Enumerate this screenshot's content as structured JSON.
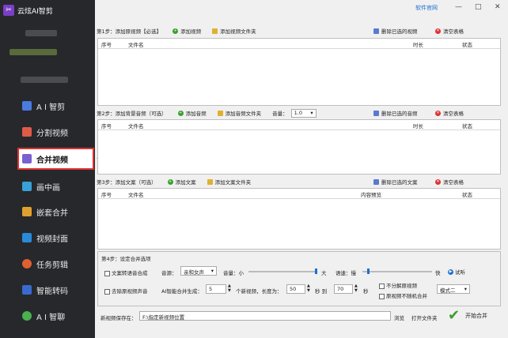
{
  "app": {
    "title": "云炫AI智剪"
  },
  "sidebar": {
    "items": [
      {
        "label": "A I 智剪",
        "color": "#4a7be0"
      },
      {
        "label": "分割视频",
        "color": "#e05a4a"
      },
      {
        "label": "合并视频",
        "color": "#7a5fd0"
      },
      {
        "label": "画中画",
        "color": "#3aa0d8"
      },
      {
        "label": "嵌套合并",
        "color": "#e0a030"
      },
      {
        "label": "视频封面",
        "color": "#2a8ad8"
      },
      {
        "label": "任务剪辑",
        "color": "#e06030"
      },
      {
        "label": "智能转码",
        "color": "#3a6ad0"
      },
      {
        "label": "A I 智聊",
        "color": "#4ab050"
      }
    ]
  },
  "titlebar": {
    "official": "软件官网",
    "minimize": "—",
    "maximize": "□",
    "close": "✕"
  },
  "step1": {
    "title": "第1步：添加原视频【必选】",
    "add": "添加视频",
    "add_folder": "添加视频文件夹",
    "delete": "删除已选的视频",
    "clear": "清空表格",
    "cols": [
      "序号",
      "文件名",
      "时长",
      "状态"
    ]
  },
  "step2": {
    "title": "第2步：添加背景音频（可选）",
    "add": "添加音频",
    "add_folder": "添加音频文件夹",
    "volume_label": "音量：",
    "volume": "1.0",
    "delete": "删除已选的音频",
    "clear": "清空表格",
    "cols": [
      "序号",
      "文件名",
      "时长",
      "状态"
    ]
  },
  "step3": {
    "title": "第3步：添加文案（可选）",
    "add": "添加文案",
    "add_folder": "添加文案文件夹",
    "delete": "删除已选的文案",
    "clear": "清空表格",
    "cols": [
      "序号",
      "文件名",
      "内容预览",
      "状态"
    ]
  },
  "step4": {
    "title": "第4步：设定合并选项",
    "tts": "文案转语音合成",
    "voice_label": "音源：",
    "voice": "亲和女声",
    "vol_label": "音量：小",
    "vol_big": "大",
    "speed_label": "语速：慢",
    "speed_fast": "快",
    "try": "试听",
    "mute": "去除原视频声音",
    "ai_label": "AI智能合并生成：",
    "ai_count": "5",
    "new_label": "个新视频，长度为：",
    "len_from": "50",
    "sec_to": "秒 到",
    "len_to": "70",
    "sec": "秒",
    "no_split": "不分解原视频",
    "no_random": "原视频不随机合并",
    "mode": "模式二"
  },
  "output": {
    "label": "新视频保存在：",
    "path": "F:\\指定新视频位置",
    "browse": "浏览",
    "open": "打开文件夹",
    "start": "开始合并"
  }
}
